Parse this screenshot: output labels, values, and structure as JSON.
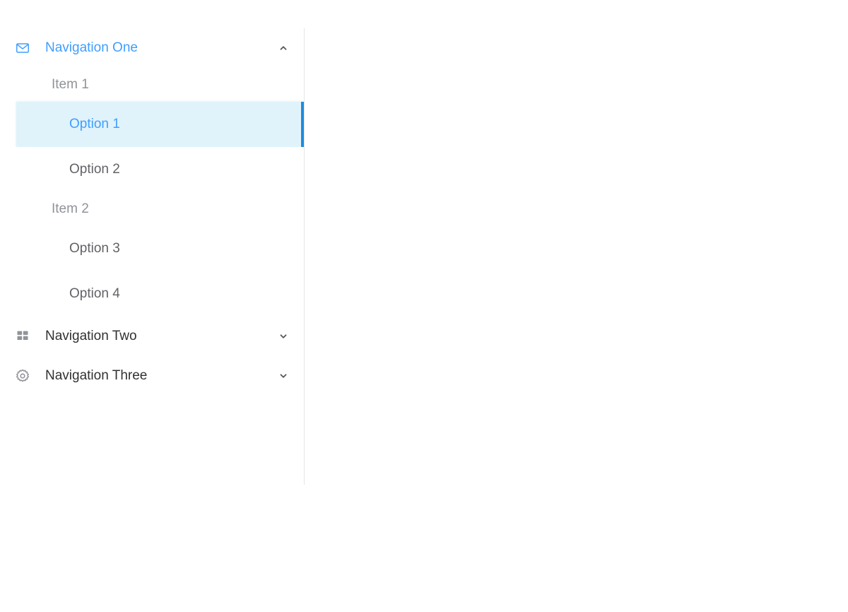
{
  "theme": {
    "accent": "#409eff",
    "selected_bar": "#1f8ce0",
    "selected_bg": "#e0f3fb",
    "text_default": "#606266",
    "text_muted": "#909399",
    "border": "#e6e6e6",
    "background": "#ffffff"
  },
  "sidebar": {
    "nav_one": {
      "label": "Navigation One",
      "icon": "envelope-icon",
      "chevron": "chevron-up-icon",
      "expanded": true,
      "active": true,
      "groups": [
        {
          "title": "Item 1",
          "items": [
            {
              "label": "Option 1",
              "selected": true
            },
            {
              "label": "Option 2",
              "selected": false
            }
          ]
        },
        {
          "title": "Item 2",
          "items": [
            {
              "label": "Option 3",
              "selected": false
            },
            {
              "label": "Option 4",
              "selected": false
            }
          ]
        }
      ]
    },
    "nav_two": {
      "label": "Navigation Two",
      "icon": "grid-icon",
      "chevron": "chevron-down-icon",
      "expanded": false,
      "active": false
    },
    "nav_three": {
      "label": "Navigation Three",
      "icon": "gear-icon",
      "chevron": "chevron-down-icon",
      "expanded": false,
      "active": false
    }
  },
  "main": {
    "content": ""
  }
}
